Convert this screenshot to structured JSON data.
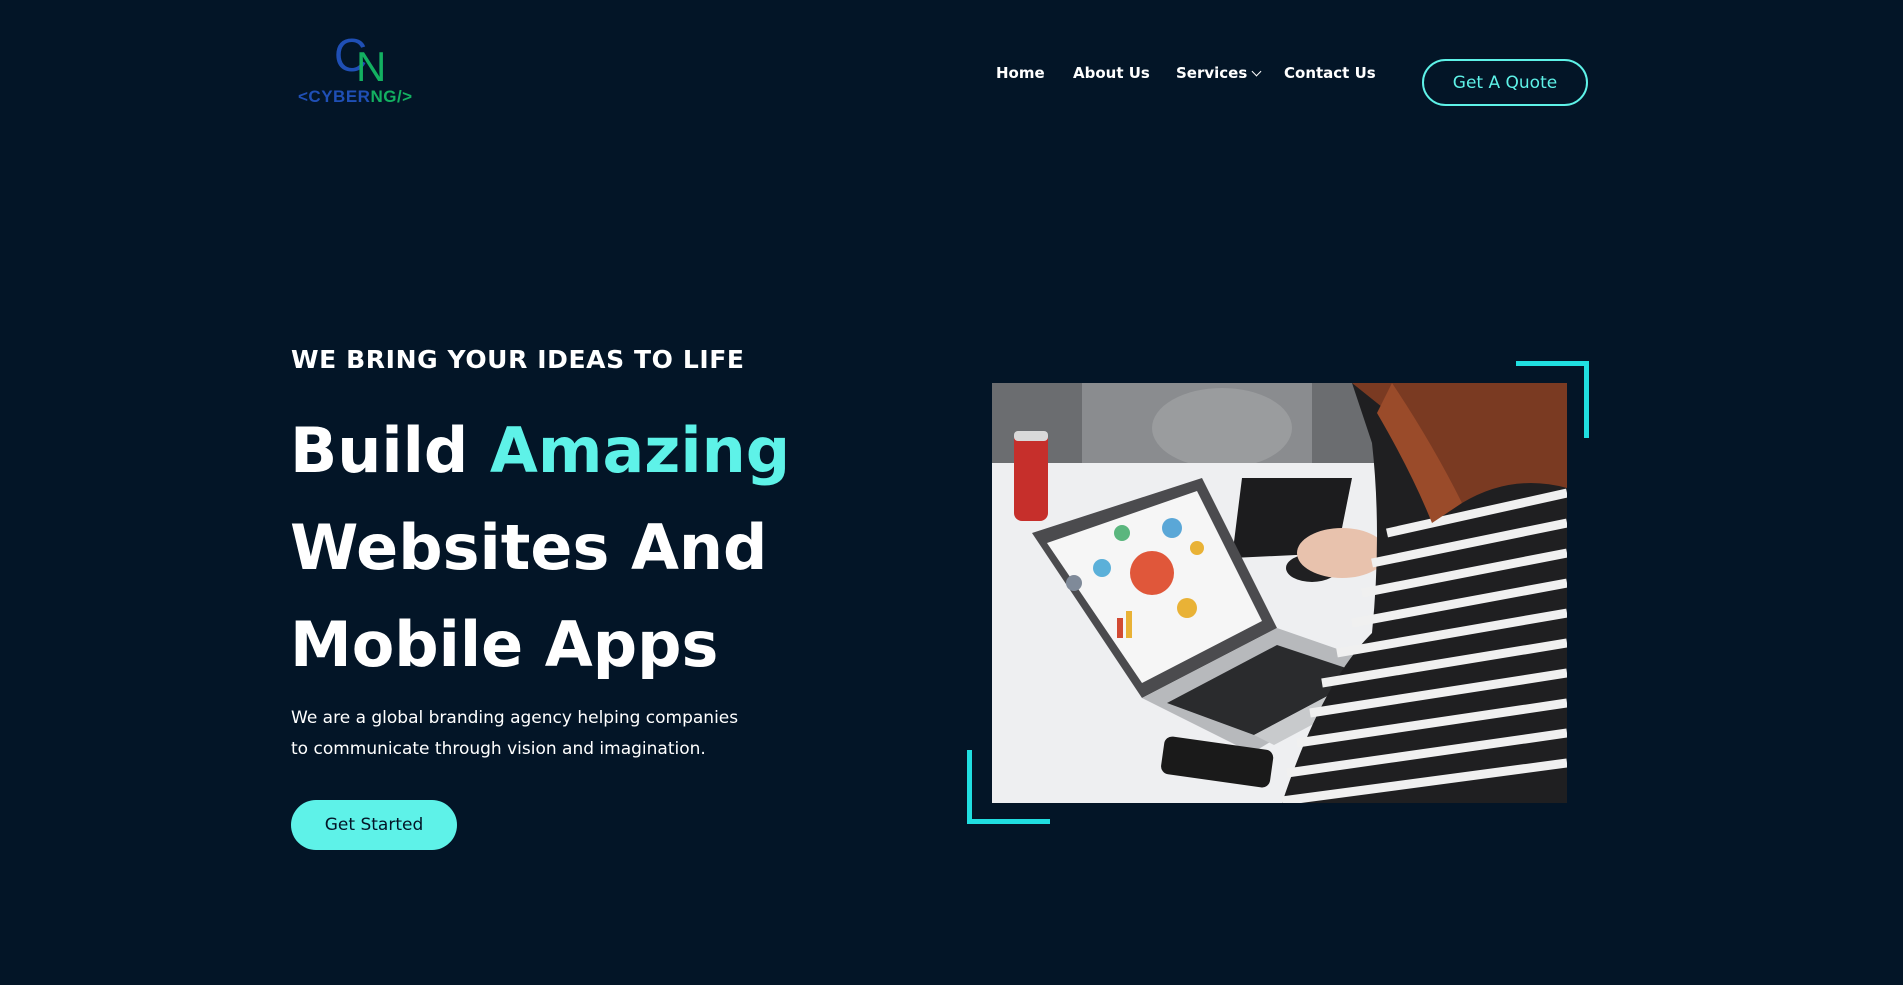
{
  "logo": {
    "mark_c": "C",
    "mark_n": "N",
    "text_part1": "<CYBER",
    "text_part2": "NG/>",
    "colors": {
      "blue": "#1f4fb5",
      "green": "#13b061"
    }
  },
  "nav": {
    "items": [
      {
        "label": "Home"
      },
      {
        "label": "About Us"
      },
      {
        "label": "Services",
        "icon": "chevron-down-icon"
      },
      {
        "label": "Contact Us"
      }
    ],
    "cta_label": "Get A Quote"
  },
  "hero": {
    "eyebrow": "WE BRING YOUR IDEAS TO LIFE",
    "headline_line1_word1": "Build",
    "headline_line1_accent": "Amazing",
    "headline_line2": "Websites And",
    "headline_line3": "Mobile Apps",
    "description": "We are a global branding agency helping companies to communicate through vision and imagination.",
    "button_label": "Get Started",
    "image": "person-working-on-laptop-photo"
  },
  "colors": {
    "background": "#031527",
    "accent": "#5ef2e8",
    "bracket": "#20dee0",
    "text": "#ffffff"
  }
}
